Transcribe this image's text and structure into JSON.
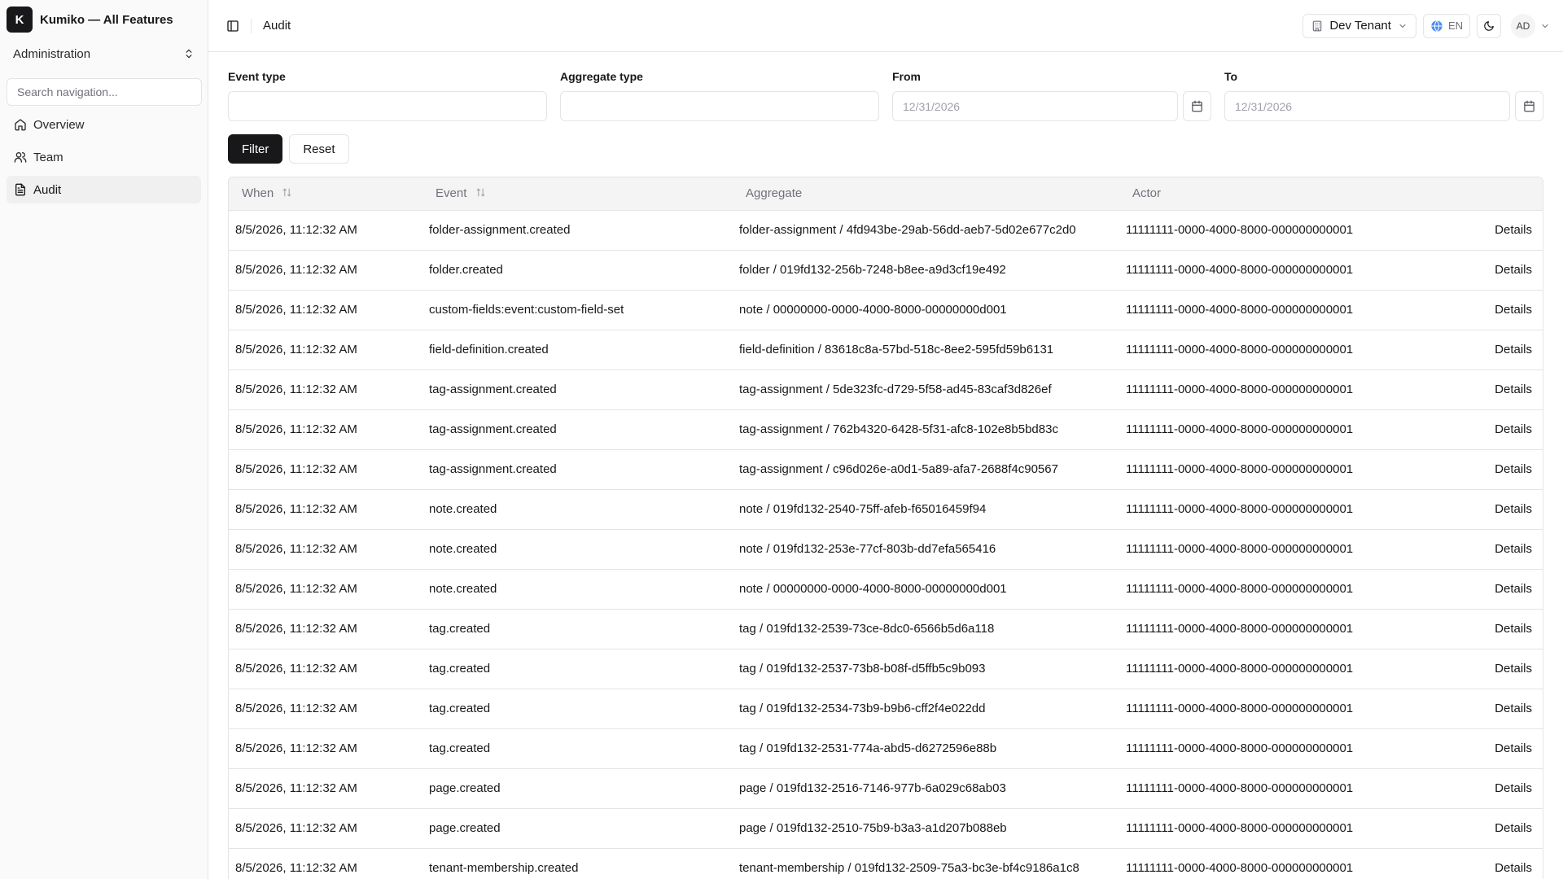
{
  "app": {
    "logo_letter": "K",
    "title": "Kumiko — All Features"
  },
  "sidebar": {
    "workspace": "Administration",
    "search_placeholder": "Search navigation...",
    "items": [
      {
        "label": "Overview",
        "icon": "home-icon",
        "active": false
      },
      {
        "label": "Team",
        "icon": "users-icon",
        "active": false
      },
      {
        "label": "Audit",
        "icon": "file-text-icon",
        "active": true
      }
    ]
  },
  "header": {
    "breadcrumb": "Audit",
    "tenant": "Dev Tenant",
    "language": "EN",
    "avatar_initials": "AD"
  },
  "filters": {
    "event_type_label": "Event type",
    "event_type_value": "",
    "aggregate_type_label": "Aggregate type",
    "aggregate_type_value": "",
    "from_label": "From",
    "from_placeholder": "12/31/2026",
    "to_label": "To",
    "to_placeholder": "12/31/2026",
    "filter_button": "Filter",
    "reset_button": "Reset"
  },
  "table": {
    "columns": {
      "when": "When",
      "event": "Event",
      "aggregate": "Aggregate",
      "actor": "Actor"
    },
    "details_label": "Details",
    "rows": [
      {
        "when": "8/5/2026, 11:12:32 AM",
        "event": "folder-assignment.created",
        "aggregate": "folder-assignment / 4fd943be-29ab-56dd-aeb7-5d02e677c2d0",
        "actor": "11111111-0000-4000-8000-000000000001"
      },
      {
        "when": "8/5/2026, 11:12:32 AM",
        "event": "folder.created",
        "aggregate": "folder / 019fd132-256b-7248-b8ee-a9d3cf19e492",
        "actor": "11111111-0000-4000-8000-000000000001"
      },
      {
        "when": "8/5/2026, 11:12:32 AM",
        "event": "custom-fields:event:custom-field-set",
        "aggregate": "note / 00000000-0000-4000-8000-00000000d001",
        "actor": "11111111-0000-4000-8000-000000000001"
      },
      {
        "when": "8/5/2026, 11:12:32 AM",
        "event": "field-definition.created",
        "aggregate": "field-definition / 83618c8a-57bd-518c-8ee2-595fd59b6131",
        "actor": "11111111-0000-4000-8000-000000000001"
      },
      {
        "when": "8/5/2026, 11:12:32 AM",
        "event": "tag-assignment.created",
        "aggregate": "tag-assignment / 5de323fc-d729-5f58-ad45-83caf3d826ef",
        "actor": "11111111-0000-4000-8000-000000000001"
      },
      {
        "when": "8/5/2026, 11:12:32 AM",
        "event": "tag-assignment.created",
        "aggregate": "tag-assignment / 762b4320-6428-5f31-afc8-102e8b5bd83c",
        "actor": "11111111-0000-4000-8000-000000000001"
      },
      {
        "when": "8/5/2026, 11:12:32 AM",
        "event": "tag-assignment.created",
        "aggregate": "tag-assignment / c96d026e-a0d1-5a89-afa7-2688f4c90567",
        "actor": "11111111-0000-4000-8000-000000000001"
      },
      {
        "when": "8/5/2026, 11:12:32 AM",
        "event": "note.created",
        "aggregate": "note / 019fd132-2540-75ff-afeb-f65016459f94",
        "actor": "11111111-0000-4000-8000-000000000001"
      },
      {
        "when": "8/5/2026, 11:12:32 AM",
        "event": "note.created",
        "aggregate": "note / 019fd132-253e-77cf-803b-dd7efa565416",
        "actor": "11111111-0000-4000-8000-000000000001"
      },
      {
        "when": "8/5/2026, 11:12:32 AM",
        "event": "note.created",
        "aggregate": "note / 00000000-0000-4000-8000-00000000d001",
        "actor": "11111111-0000-4000-8000-000000000001"
      },
      {
        "when": "8/5/2026, 11:12:32 AM",
        "event": "tag.created",
        "aggregate": "tag / 019fd132-2539-73ce-8dc0-6566b5d6a118",
        "actor": "11111111-0000-4000-8000-000000000001"
      },
      {
        "when": "8/5/2026, 11:12:32 AM",
        "event": "tag.created",
        "aggregate": "tag / 019fd132-2537-73b8-b08f-d5ffb5c9b093",
        "actor": "11111111-0000-4000-8000-000000000001"
      },
      {
        "when": "8/5/2026, 11:12:32 AM",
        "event": "tag.created",
        "aggregate": "tag / 019fd132-2534-73b9-b9b6-cff2f4e022dd",
        "actor": "11111111-0000-4000-8000-000000000001"
      },
      {
        "when": "8/5/2026, 11:12:32 AM",
        "event": "tag.created",
        "aggregate": "tag / 019fd132-2531-774a-abd5-d6272596e88b",
        "actor": "11111111-0000-4000-8000-000000000001"
      },
      {
        "when": "8/5/2026, 11:12:32 AM",
        "event": "page.created",
        "aggregate": "page / 019fd132-2516-7146-977b-6a029c68ab03",
        "actor": "11111111-0000-4000-8000-000000000001"
      },
      {
        "when": "8/5/2026, 11:12:32 AM",
        "event": "page.created",
        "aggregate": "page / 019fd132-2510-75b9-b3a3-a1d207b088eb",
        "actor": "11111111-0000-4000-8000-000000000001"
      },
      {
        "when": "8/5/2026, 11:12:32 AM",
        "event": "tenant-membership.created",
        "aggregate": "tenant-membership / 019fd132-2509-75a3-bc3e-bf4c9186a1c8",
        "actor": "11111111-0000-4000-8000-000000000001"
      }
    ]
  }
}
